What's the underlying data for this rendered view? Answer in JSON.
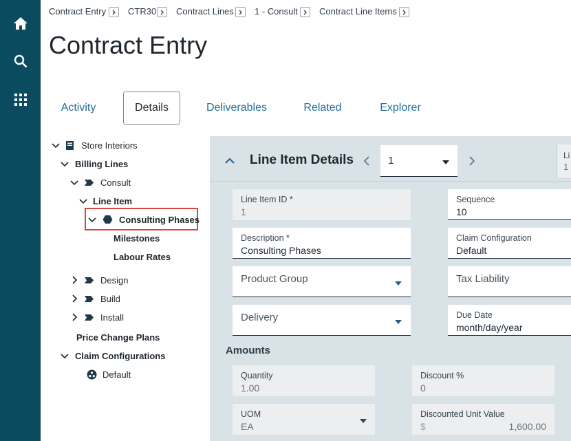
{
  "breadcrumb": [
    "Contract Entry",
    "CTR30",
    "Contract Lines",
    "1 - Consult",
    "Contract Line Items"
  ],
  "page": {
    "title": "Contract Entry"
  },
  "tabs": [
    {
      "label": "Activity",
      "active": false
    },
    {
      "label": "Details",
      "active": true
    },
    {
      "label": "Deliverables",
      "active": false
    },
    {
      "label": "Related",
      "active": false
    },
    {
      "label": "Explorer",
      "active": false
    }
  ],
  "tree": {
    "root": "Store Interiors",
    "billing_lines": "Billing Lines",
    "consult": "Consult",
    "line_item": "Line Item",
    "consulting_phases": "Consulting Phases",
    "milestones": "Milestones",
    "labour_rates": "Labour Rates",
    "design": "Design",
    "build": "Build",
    "install": "Install",
    "price_change_plans": "Price Change Plans",
    "claim_configurations": "Claim Configurations",
    "default": "Default"
  },
  "details": {
    "title": "Line Item Details",
    "selector_value": "1",
    "peek_label": "Li",
    "peek_value": "1",
    "fields": {
      "line_item_id": {
        "label": "Line Item ID *",
        "value": "1"
      },
      "sequence": {
        "label": "Sequence",
        "value": "10"
      },
      "description": {
        "label": "Description *",
        "value": "Consulting Phases"
      },
      "claim_configuration": {
        "label": "Claim Configuration",
        "value": "Default"
      },
      "product_group": {
        "label": "Product Group"
      },
      "tax_liability": {
        "label": "Tax Liability"
      },
      "delivery": {
        "label": "Delivery"
      },
      "due_date": {
        "label": "Due Date",
        "value": "month/day/year"
      }
    },
    "amounts": {
      "heading": "Amounts",
      "quantity": {
        "label": "Quantity",
        "value": "1.00"
      },
      "discount_pct": {
        "label": "Discount %",
        "value": "0"
      },
      "uom": {
        "label": "UOM",
        "value": "EA"
      },
      "discounted_unit_value": {
        "label": "Discounted Unit Value",
        "currency": "$",
        "value": "1,600.00"
      }
    }
  },
  "icons": [
    "home-icon",
    "search-icon",
    "apps-grid-icon",
    "book-icon",
    "tag-icon",
    "hexagon-icon",
    "claim-config-icon"
  ],
  "colors": {
    "rail": "#0a4b5f",
    "link": "#1f6e9b",
    "panel": "#d9e2e6",
    "highlight": "#d9453d"
  }
}
